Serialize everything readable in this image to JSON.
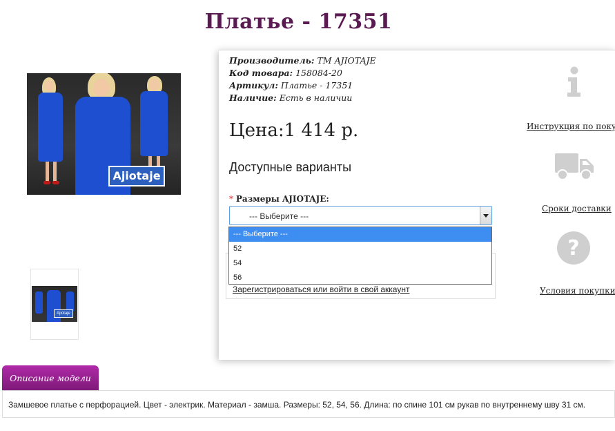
{
  "product": {
    "title": "Платье - 17351",
    "main_image_brand": "Ajiotaje",
    "thumb_brand": "Ajiotaje"
  },
  "specs": [
    {
      "label": "Производитель:",
      "value": "ТМ AJIOTAJE"
    },
    {
      "label": "Код товара:",
      "value": "158084-20"
    },
    {
      "label": "Артикул:",
      "value": "Платье - 17351"
    },
    {
      "label": "Наличие:",
      "value": "Есть в наличии"
    }
  ],
  "price": "Цена:1 414 р.",
  "options": {
    "title": "Доступные варианты",
    "size_required_mark": "*",
    "size_label": "Размеры AJIOTAJE:",
    "selected": "--- Выберите ---",
    "dropdown_items": [
      "--- Выберите ---",
      "52",
      "54",
      "56"
    ]
  },
  "login_link": "Зарегистрироваться или войти в свой аккаунт",
  "sidebar": {
    "instruction": "Инструкция по покупк",
    "delivery": "Сроки доставки",
    "terms": "Условия покупки"
  },
  "tabs": {
    "description_tab": "Описание модели",
    "description_text": "Замшевое платье с перфорацией. Цвет - электрик. Материал - замша. Размеры: 52, 54, 56. Длина: по спине 101 см рукав по внутреннему шву 31 см."
  },
  "colors": {
    "title": "#5a1a52",
    "tab": "#9a2194",
    "dress": "#1f4fd1",
    "dropdown_highlight": "#3d8ef0"
  }
}
